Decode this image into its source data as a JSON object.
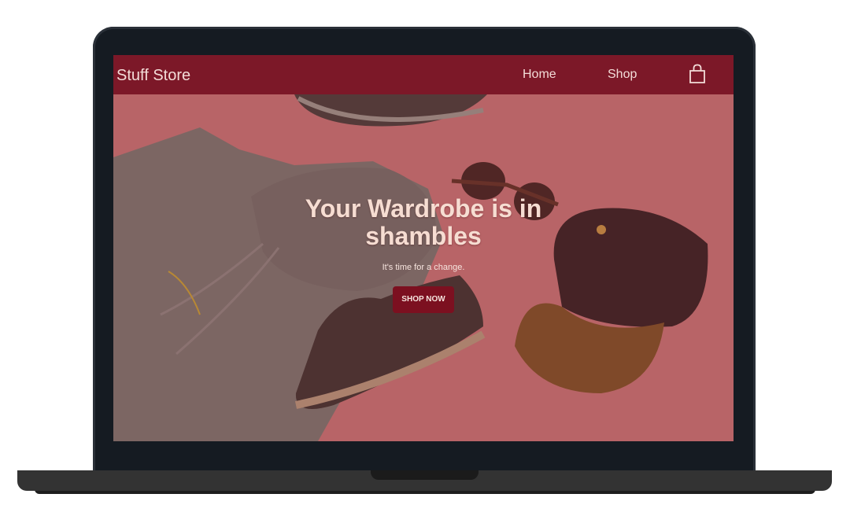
{
  "navbar": {
    "brand": "Stuff Store",
    "links": [
      {
        "label": "Home"
      },
      {
        "label": "Shop"
      }
    ],
    "cart_icon": "shopping-bag-icon"
  },
  "hero": {
    "title": "Your Wardrobe is in shambles",
    "subtitle": "It's time for a change.",
    "button_label": "SHOP NOW",
    "background_image": "flat-lay of hoodie, sneakers, sunglasses and cap on pink background"
  },
  "colors": {
    "navbar": "#7c1828",
    "button": "#7c1020",
    "hero_text": "#f6ddd2",
    "bezel": "#151b22",
    "base": "#333333"
  }
}
